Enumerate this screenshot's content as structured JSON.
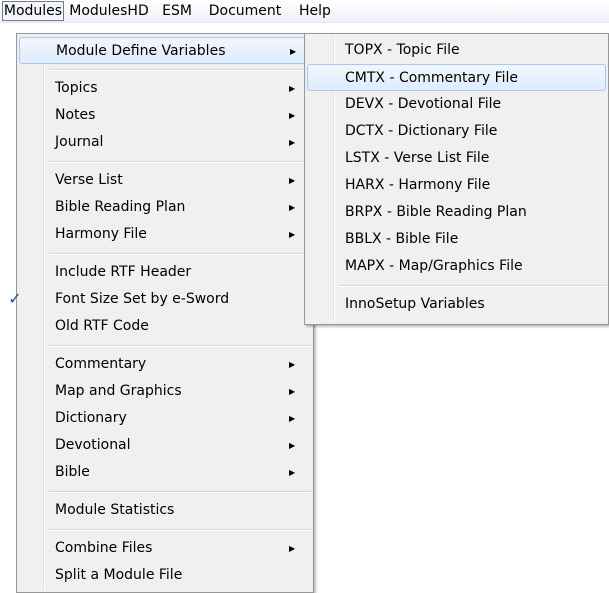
{
  "menubar": {
    "items": [
      "Modules",
      "ModulesHD",
      "ESM",
      "Document",
      "Help"
    ]
  },
  "modules_menu": {
    "items": [
      "Module Define Variables",
      "Topics",
      "Notes",
      "Journal",
      "Verse List",
      "Bible Reading Plan",
      "Harmony File",
      "Include RTF Header",
      "Font Size Set by e-Sword",
      "Old RTF Code",
      "Commentary",
      "Map and Graphics",
      "Dictionary",
      "Devotional",
      "Bible",
      "Module Statistics",
      "Combine Files",
      "Split a Module File"
    ],
    "check_mark": "✓",
    "arrow": "▶"
  },
  "submenu": {
    "items": [
      "TOPX - Topic File",
      "CMTX - Commentary File",
      "DEVX - Devotional File",
      "DCTX - Dictionary File",
      "LSTX - Verse List File",
      "HARX - Harmony File",
      "BRPX - Bible Reading Plan",
      "BBLX - Bible File",
      "MAPX - Map/Graphics File",
      "InnoSetup Variables"
    ]
  }
}
